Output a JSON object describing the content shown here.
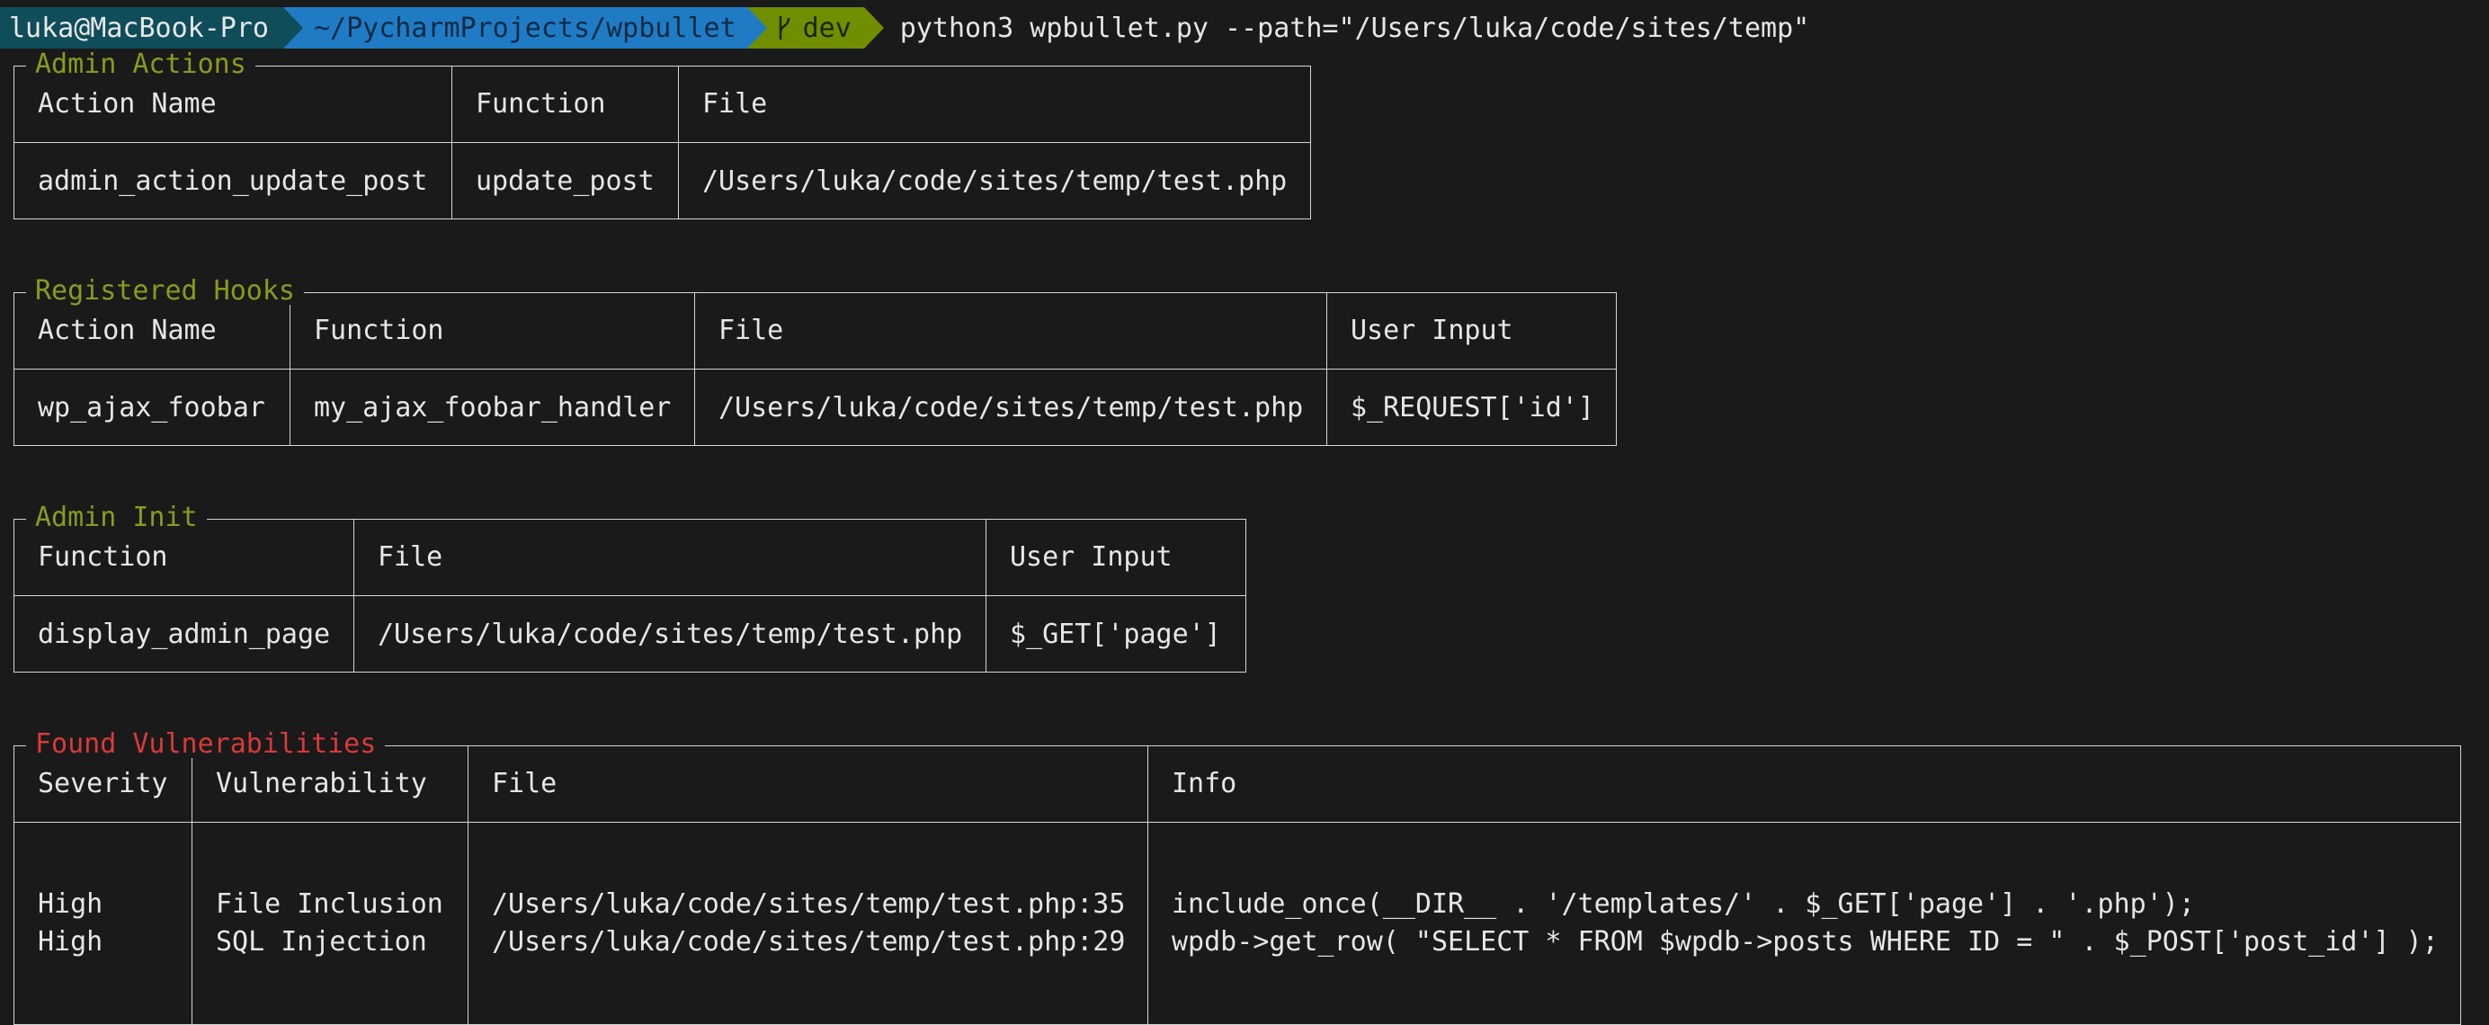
{
  "prompt": {
    "user_host": "luka@MacBook-Pro",
    "path": "~/PycharmProjects/wpbullet",
    "branch": "dev",
    "command": "python3 wpbullet.py --path=\"/Users/luka/code/sites/temp\"",
    "branch_icon": "git-branch-icon",
    "colors": {
      "user_bg": "#0f4d5a",
      "path_bg": "#1f7cc4",
      "git_bg": "#6f8f00"
    }
  },
  "admin_actions": {
    "title": "Admin Actions",
    "columns": [
      "Action Name",
      "Function",
      "File"
    ],
    "rows": [
      [
        "admin_action_update_post",
        "update_post",
        "/Users/luka/code/sites/temp/test.php"
      ]
    ]
  },
  "registered_hooks": {
    "title": "Registered Hooks",
    "columns": [
      "Action Name",
      "Function",
      "File",
      "User Input"
    ],
    "rows": [
      [
        "wp_ajax_foobar",
        "my_ajax_foobar_handler",
        "/Users/luka/code/sites/temp/test.php",
        "$_REQUEST['id']"
      ]
    ]
  },
  "admin_init": {
    "title": "Admin Init",
    "columns": [
      "Function",
      "File",
      "User Input"
    ],
    "rows": [
      [
        "display_admin_page",
        "/Users/luka/code/sites/temp/test.php",
        "$_GET['page']"
      ]
    ]
  },
  "vulnerabilities": {
    "title": "Found Vulnerabilities",
    "columns": [
      "Severity",
      "Vulnerability",
      "File",
      "Info"
    ],
    "rows": [
      [
        "High",
        "File Inclusion",
        "/Users/luka/code/sites/temp/test.php:35",
        "include_once(__DIR__ . '/templates/' . $_GET['page'] . '.php');"
      ],
      [
        "High",
        "SQL Injection",
        "/Users/luka/code/sites/temp/test.php:29",
        "wpdb->get_row( \"SELECT * FROM $wpdb->posts WHERE ID = \" . $_POST['post_id'] );"
      ]
    ],
    "title_color": "#d83a3a"
  },
  "section_title_color": "#8a9a1e"
}
